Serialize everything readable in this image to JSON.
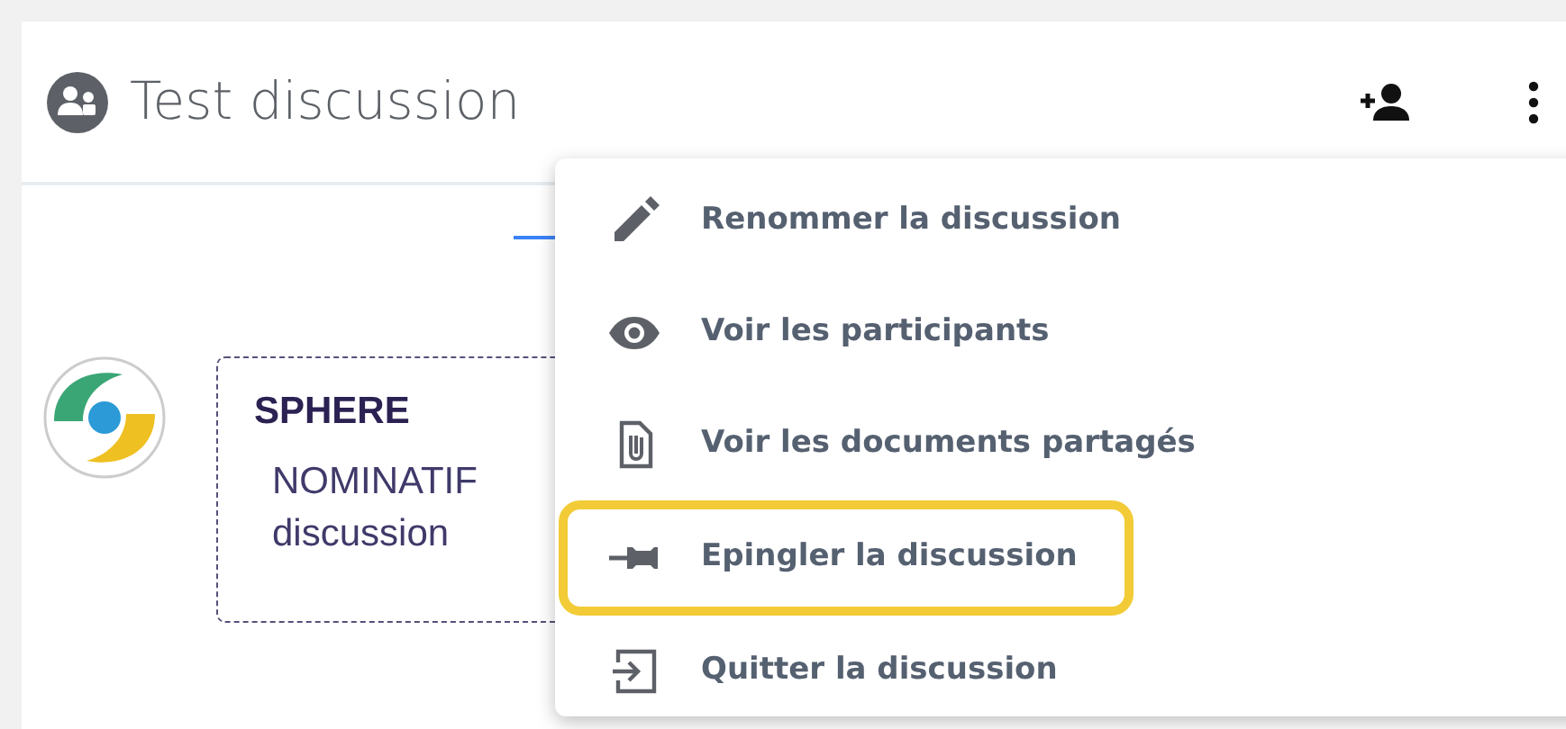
{
  "header": {
    "title": "Test discussion"
  },
  "message": {
    "sender": "SPHERE",
    "lines": [
      "NOMINATIF",
      "discussion"
    ]
  },
  "menu": {
    "items": [
      {
        "label": "Renommer la discussion",
        "highlighted": false
      },
      {
        "label": "Voir les participants",
        "highlighted": false
      },
      {
        "label": "Voir les documents partagés",
        "highlighted": false
      },
      {
        "label": "Epingler la discussion",
        "highlighted": true
      },
      {
        "label": "Quitter la discussion",
        "highlighted": false
      }
    ]
  }
}
